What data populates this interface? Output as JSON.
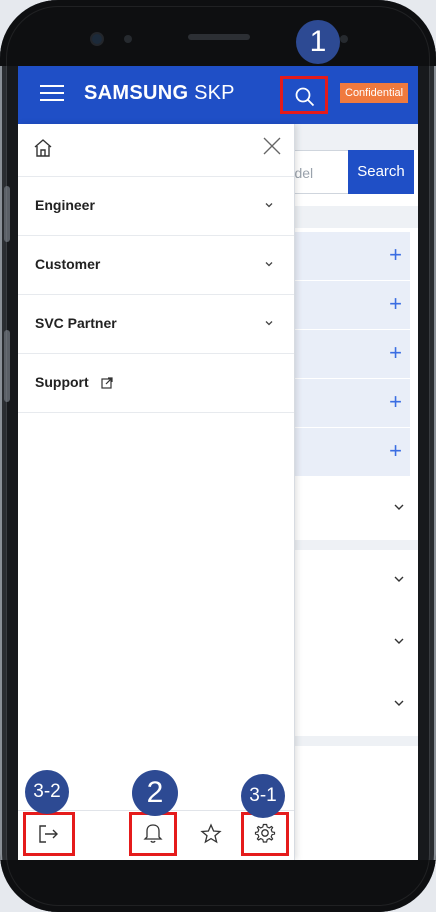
{
  "header": {
    "brand_bold": "SAMSUNG",
    "brand_light": "SKP",
    "badge": "Confidential",
    "color": "#1f4fc6"
  },
  "background_page": {
    "search_placeholder": "model",
    "search_button": "Search",
    "plus_rows": [
      "+",
      "+",
      "+",
      "+",
      "+"
    ],
    "chevron_rows": 4
  },
  "drawer": {
    "home_icon": "home-icon",
    "close_icon": "close-icon",
    "items": [
      {
        "label": "Engineer",
        "icon": "chevron-down-icon"
      },
      {
        "label": "Customer",
        "icon": "chevron-down-icon"
      },
      {
        "label": "SVC Partner",
        "icon": "chevron-down-icon"
      },
      {
        "label": "Support",
        "icon": "external-link-icon"
      }
    ],
    "footer": {
      "icons": [
        "logout-icon",
        "bell-icon",
        "star-icon",
        "gear-icon"
      ]
    }
  },
  "callouts": {
    "c1": "1",
    "c2": "2",
    "c3_1": "3-1",
    "c3_2": "3-2"
  },
  "colors": {
    "brand_blue": "#1f4fc6",
    "highlight_red": "#e51b1b",
    "callout_navy": "#2d4a93",
    "badge_orange": "#f07a3e"
  }
}
